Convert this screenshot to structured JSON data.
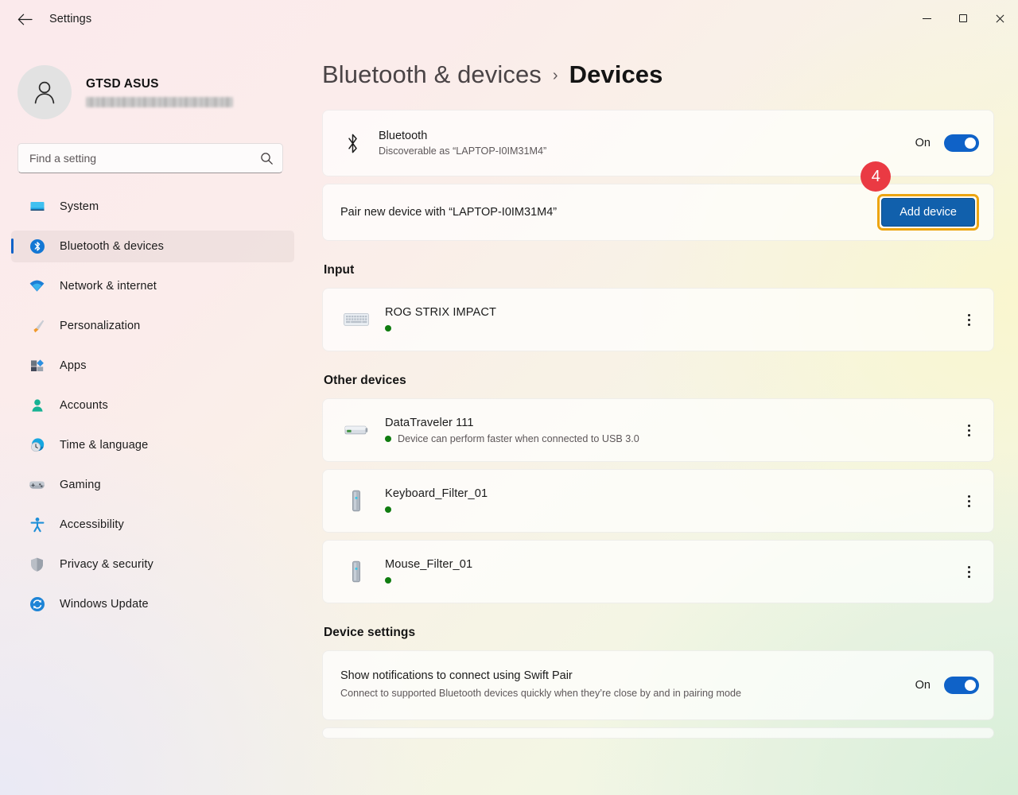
{
  "window": {
    "title": "Settings",
    "back_icon": "back-arrow-icon",
    "minimize_label": "Minimize",
    "maximize_label": "Maximize",
    "close_label": "Close"
  },
  "account": {
    "name": "GTSD ASUS",
    "email_redacted": true,
    "avatar_icon": "person-avatar-icon"
  },
  "search": {
    "placeholder": "Find a setting",
    "value": "",
    "icon": "search-icon"
  },
  "sidebar": {
    "items": [
      {
        "label": "System",
        "icon": "system-monitor-icon",
        "active": false
      },
      {
        "label": "Bluetooth & devices",
        "icon": "bluetooth-icon",
        "active": true
      },
      {
        "label": "Network & internet",
        "icon": "wifi-icon",
        "active": false
      },
      {
        "label": "Personalization",
        "icon": "paintbrush-icon",
        "active": false
      },
      {
        "label": "Apps",
        "icon": "apps-grid-icon",
        "active": false
      },
      {
        "label": "Accounts",
        "icon": "person-icon",
        "active": false
      },
      {
        "label": "Time & language",
        "icon": "clock-globe-icon",
        "active": false
      },
      {
        "label": "Gaming",
        "icon": "gamepad-icon",
        "active": false
      },
      {
        "label": "Accessibility",
        "icon": "accessibility-person-icon",
        "active": false
      },
      {
        "label": "Privacy & security",
        "icon": "shield-icon",
        "active": false
      },
      {
        "label": "Windows Update",
        "icon": "refresh-sync-icon",
        "active": false
      }
    ]
  },
  "breadcrumb": {
    "parent": "Bluetooth & devices",
    "separator": "›",
    "current": "Devices"
  },
  "bluetooth_card": {
    "icon": "bluetooth-glyph-icon",
    "title": "Bluetooth",
    "subtitle": "Discoverable as “LAPTOP-I0IM31M4”",
    "toggle_state": "On"
  },
  "pair_card": {
    "text": "Pair new device with “LAPTOP-I0IM31M4”",
    "button_label": "Add device",
    "highlighted": true,
    "step_number": "4"
  },
  "sections": [
    {
      "heading": "Input",
      "devices": [
        {
          "name": "ROG STRIX IMPACT",
          "icon": "keyboard-icon",
          "status_dot": "green",
          "subtitle": ""
        }
      ]
    },
    {
      "heading": "Other devices",
      "devices": [
        {
          "name": "DataTraveler 111",
          "icon": "usb-drive-icon",
          "status_dot": "green",
          "subtitle": "Device can perform faster when connected to USB 3.0"
        },
        {
          "name": "Keyboard_Filter_01",
          "icon": "device-tower-icon",
          "status_dot": "green",
          "subtitle": ""
        },
        {
          "name": "Mouse_Filter_01",
          "icon": "device-tower-icon",
          "status_dot": "green",
          "subtitle": ""
        }
      ]
    }
  ],
  "device_settings": {
    "heading": "Device settings",
    "swift_pair": {
      "title": "Show notifications to connect using Swift Pair",
      "subtitle": "Connect to supported Bluetooth devices quickly when they’re close by and in pairing mode",
      "toggle_state": "On"
    }
  },
  "colors": {
    "accent_blue": "#0f62c8",
    "button_blue": "#1160ac",
    "highlight_amber": "#eda511",
    "badge_red": "#ea3a43",
    "status_green": "#107c10"
  },
  "kebab_icon": "more-options-icon"
}
